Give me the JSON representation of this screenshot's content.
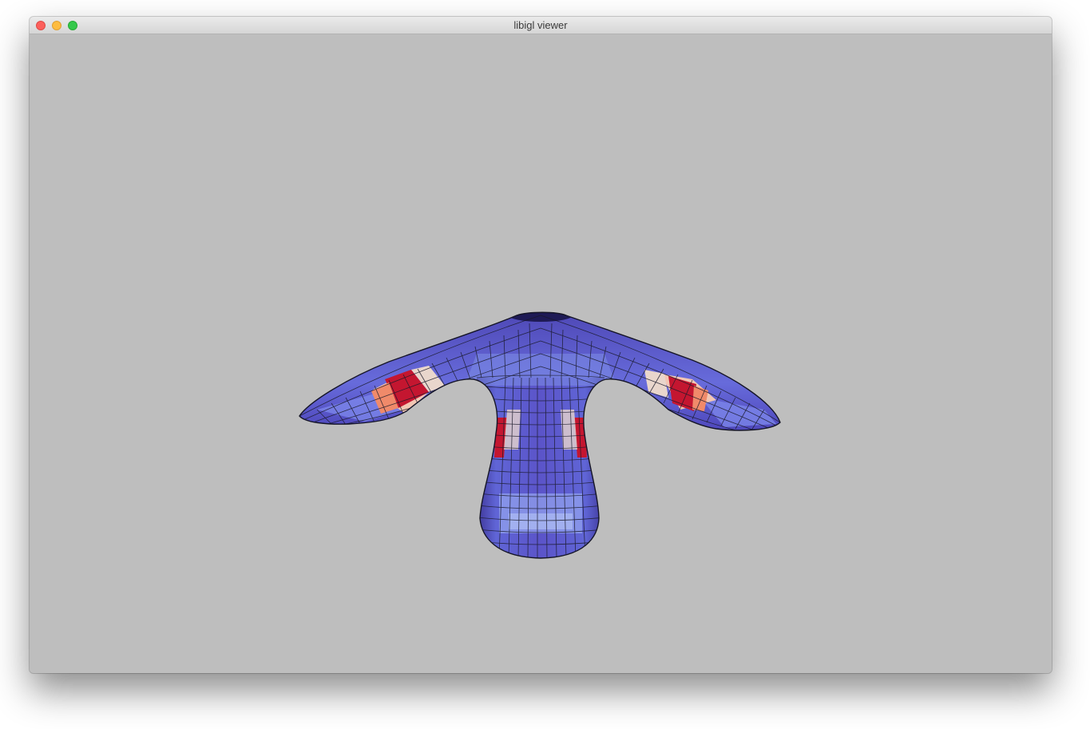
{
  "window": {
    "title": "libigl viewer"
  },
  "viewport": {
    "background": "#bebebe",
    "mesh": {
      "colormap": "blue-white-red",
      "colors": {
        "low": "#4b43b8",
        "mid_low": "#8ea6f0",
        "mid": "#e9d6cc",
        "mid_high": "#f08a6a",
        "high": "#c41630"
      },
      "wireframe": true,
      "wireframe_color": "#1a1a2a"
    }
  },
  "icons": {
    "close": "close-dot-icon",
    "minimize": "minimize-dot-icon",
    "maximize": "maximize-dot-icon"
  }
}
